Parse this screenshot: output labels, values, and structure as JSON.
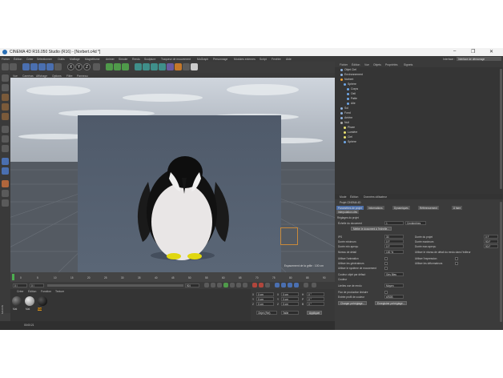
{
  "window": {
    "title": "CINEMA 4D R16.050 Studio (R16) - [Norbert.c4d *]",
    "minimize": "–",
    "maximize": "❐",
    "close": "✕"
  },
  "menubar": {
    "items": [
      "Fichier",
      "Édition",
      "Créer",
      "Sélectionner",
      "Outils",
      "Maillage",
      "Magnétisme",
      "Animer",
      "Simuler",
      "Rendu",
      "Sculpture",
      "Traqueur de mouvement",
      "MoGraph",
      "Personnage",
      "Modules externes",
      "Script",
      "Fenêtre",
      "Aide"
    ],
    "interface_label": "Interface :",
    "interface_value": "Interface de démarrage"
  },
  "toolbar": {
    "icons": [
      "undo-icon",
      "redo-icon",
      "live-select-icon",
      "move-icon",
      "scale-icon",
      "rotate-icon",
      "object-mode-icon",
      "x-axis-icon",
      "y-axis-icon",
      "z-axis-icon",
      "coordinate-system-icon",
      "render-view-icon",
      "render-picture-viewer-icon",
      "render-settings-icon",
      "cube-icon",
      "pen-icon",
      "subdivision-icon",
      "array-icon",
      "deformer-icon",
      "floor-icon",
      "camera-icon",
      "light-icon"
    ],
    "axis_x": "X",
    "axis_y": "Y",
    "axis_z": "Z"
  },
  "viewport": {
    "menu": [
      "Vue",
      "Caméras",
      "Affichage",
      "Options",
      "Filtre",
      "Panneau"
    ],
    "grid_label": "Espacement de la grille : 100 cm"
  },
  "timeline": {
    "ticks": [
      "0",
      "5",
      "10",
      "15",
      "20",
      "25",
      "30",
      "35",
      "40",
      "45",
      "50",
      "55",
      "60",
      "65",
      "70",
      "75",
      "80",
      "85",
      "90"
    ],
    "frame_start": "0 I",
    "frame_end": "90 I",
    "current": "0 I"
  },
  "materials": {
    "menu": [
      "Créer",
      "Édition",
      "Fonction",
      "Texture"
    ],
    "items": [
      "Mat",
      "Mat",
      "Mat"
    ]
  },
  "coordinates": {
    "rows": [
      {
        "axis": "X",
        "value": "0 cm",
        "axis2": "X",
        "value2": "0 cm",
        "axis3": "H",
        "value3": "0 °"
      },
      {
        "axis": "Y",
        "value": "0 cm",
        "axis2": "Y",
        "value2": "0 cm",
        "axis3": "P",
        "value3": "0 °"
      },
      {
        "axis": "Z",
        "value": "0 cm",
        "axis2": "Z",
        "value2": "0 cm",
        "axis3": "B",
        "value3": "0 °"
      }
    ],
    "mode": "Objet (Rel)",
    "size_mode": "Taille",
    "apply": "Appliquer"
  },
  "statusbar": {
    "text": "00:00:21"
  },
  "objects": {
    "tabs": [
      "Fichier",
      "Édition",
      "Vue",
      "Objets",
      "Propriétés",
      "Signets"
    ],
    "rows": [
      {
        "name": "Objet Ciel",
        "indent": 1,
        "color": "#8fb3e0"
      },
      {
        "name": "Environnement",
        "indent": 1,
        "color": "#8fb3e0"
      },
      {
        "name": "Norbert",
        "indent": 1,
        "color": "#f0a030"
      },
      {
        "name": "Sphère",
        "indent": 2,
        "color": "#6fa8e8"
      },
      {
        "name": "Corps",
        "indent": 3,
        "color": "#6fa8e8"
      },
      {
        "name": "Oeil",
        "indent": 3,
        "color": "#6fa8e8"
      },
      {
        "name": "Patte",
        "indent": 3,
        "color": "#6fa8e8"
      },
      {
        "name": "Aile",
        "indent": 3,
        "color": "#6fa8e8"
      },
      {
        "name": "Sol",
        "indent": 1,
        "color": "#8fb3e0"
      },
      {
        "name": "Fond",
        "indent": 1,
        "color": "#8fb3e0"
      },
      {
        "name": "Arrière",
        "indent": 1,
        "color": "#8fb3e0"
      },
      {
        "name": "Null",
        "indent": 1,
        "color": "#aaaaaa"
      },
      {
        "name": "Phare",
        "indent": 2,
        "color": "#e8e070"
      },
      {
        "name": "Lumière",
        "indent": 2,
        "color": "#e8e070"
      },
      {
        "name": "Ciel",
        "indent": 2,
        "color": "#e8e070"
      },
      {
        "name": "Sphère",
        "indent": 2,
        "color": "#6fa8e8"
      }
    ]
  },
  "attributes": {
    "tabs": [
      "Mode",
      "Édition",
      "Données utilisateur"
    ],
    "header": "Projet CINEMA 4D",
    "subtabs": [
      "Paramètres de projet",
      "Informations",
      "Dynamiques",
      "Référencement",
      "À faire"
    ],
    "subtabs2": [
      "Interpolation clés"
    ],
    "section": "Réglages du projet",
    "scale_label": "Échelle du document",
    "scale_value": "1",
    "scale_unit": "Centimètres",
    "scale_button": "Mettre le document à l'échelle...",
    "fields_left": [
      {
        "label": "IPS",
        "value": "30"
      },
      {
        "label": "Durée minimum",
        "value": "0 F"
      },
      {
        "label": "Durée min aperçu",
        "value": "0 F"
      },
      {
        "label": "Niveau de détail",
        "value": "100 %"
      }
    ],
    "fields_right": [
      {
        "label": "Durée du projet",
        "value": "0 F"
      },
      {
        "label": "Durée maximum",
        "value": "90 F"
      },
      {
        "label": "Durée max aperçu",
        "value": "90 F"
      }
    ],
    "lod_note": "Utiliser le niveau de détail du rendu dans l'éditeur",
    "checks_left": [
      "Utiliser l'animation",
      "Utiliser les générateurs",
      "Utiliser le système de mouvement",
      "Utiliser le système de mouvement"
    ],
    "checks_right": [
      "Utiliser l'expression",
      "Utiliser les déformateurs"
    ],
    "color_label": "Couleur objet par défaut",
    "color_value": "Gris Bleu",
    "color2_label": "Couleur",
    "view_clip_label": "Limites vue de rendu",
    "view_clip_value": "Moyen",
    "linear_label": "Flux de production linéaire",
    "profile_label": "Entrée profil de couleur",
    "profile_value": "sRGB",
    "load_button": "Charger préréglage...",
    "save_button": "Enregistrer préréglage..."
  }
}
